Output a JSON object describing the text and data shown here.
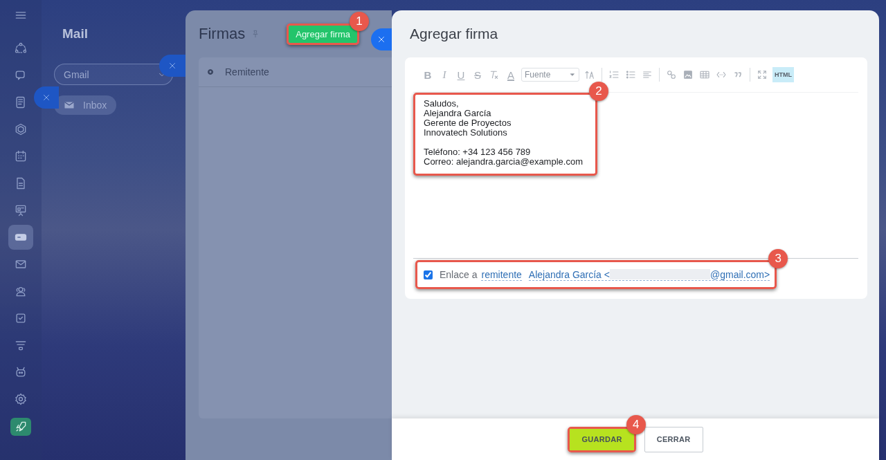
{
  "sidebar": {
    "items": [
      {
        "kind": "nodes",
        "selected": false
      },
      {
        "kind": "chat",
        "selected": false
      },
      {
        "kind": "feed",
        "selected": false
      },
      {
        "kind": "hexagon",
        "selected": false
      },
      {
        "kind": "calendar",
        "selected": false
      },
      {
        "kind": "document",
        "selected": false
      },
      {
        "kind": "board",
        "selected": false
      },
      {
        "kind": "card",
        "selected": true
      },
      {
        "kind": "mail",
        "selected": false
      },
      {
        "kind": "people",
        "selected": false
      },
      {
        "kind": "task",
        "selected": false
      },
      {
        "kind": "funnel",
        "selected": false
      },
      {
        "kind": "robot",
        "selected": false
      },
      {
        "kind": "gear",
        "selected": false
      },
      {
        "kind": "rocket",
        "selected": true
      }
    ]
  },
  "mail": {
    "title": "Mail",
    "mailbox_select": {
      "value": "Gmail"
    },
    "folders": [
      {
        "label": "Inbox"
      }
    ]
  },
  "signatures": {
    "title": "Firmas",
    "add_button": {
      "label": "Agregar firma",
      "callout": "1"
    },
    "table": {
      "columns": [
        "Remitente"
      ]
    }
  },
  "editor": {
    "title": "Agregar firma",
    "toolbar": {
      "groups": [
        [
          {
            "kind": "bold",
            "label": "B"
          },
          {
            "kind": "italic",
            "label": "I"
          },
          {
            "kind": "underline",
            "label": "U"
          },
          {
            "kind": "strike",
            "label": "S"
          },
          {
            "kind": "clear"
          },
          {
            "kind": "color",
            "label": "A"
          },
          {
            "kind": "font",
            "label": "Fuente"
          },
          {
            "kind": "size"
          }
        ],
        [
          {
            "kind": "numbered"
          },
          {
            "kind": "bullets"
          },
          {
            "kind": "align"
          }
        ],
        [
          {
            "kind": "link"
          },
          {
            "kind": "image"
          },
          {
            "kind": "table"
          },
          {
            "kind": "code"
          },
          {
            "kind": "quote"
          }
        ],
        [
          {
            "kind": "fullscreen"
          }
        ]
      ],
      "html_button": {
        "label": "HTML",
        "selected": true
      }
    },
    "body": {
      "callout": "2",
      "paragraphs": [
        [
          "Saludos,",
          "Alejandra García",
          "Gerente de Proyectos",
          "Innovatech Solutions"
        ],
        [
          "Teléfono: +34 123 456 789",
          "Correo: alejandra.garcia@example.com"
        ]
      ]
    },
    "link_option": {
      "callout": "3",
      "checked": true,
      "label": "Enlace a",
      "link": "remitente",
      "sender_prefix": "Alejandra García <",
      "sender_suffix": "@gmail.com>"
    },
    "buttons": {
      "save": {
        "label": "GUARDAR",
        "callout": "4"
      },
      "close": {
        "label": "CERRAR"
      }
    }
  }
}
